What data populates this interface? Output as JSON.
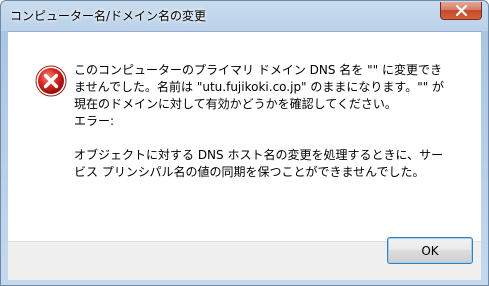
{
  "window": {
    "title": "コンピューター名/ドメイン名の変更"
  },
  "message": {
    "lines": [
      "このコンピューターのプライマリ ドメイン DNS 名を \"\" に変更でき",
      "ませんでした。名前は \"utu.fujikoki.co.jp\" のままになります。\"\" が",
      "現在のドメインに対して有効かどうかを確認してください。",
      "エラー:",
      "",
      "オブジェクトに対する DNS ホスト名の変更を処理するときに、サー",
      "ビス プリンシパル名の値の同期を保つことができませんでした。"
    ]
  },
  "buttons": {
    "ok_label": "OK"
  },
  "icons": {
    "close": "close-icon",
    "error": "error-icon"
  },
  "colors": {
    "error_red": "#d9251d",
    "close_button": "#c4482a",
    "focus_border": "#3c7fb1"
  }
}
